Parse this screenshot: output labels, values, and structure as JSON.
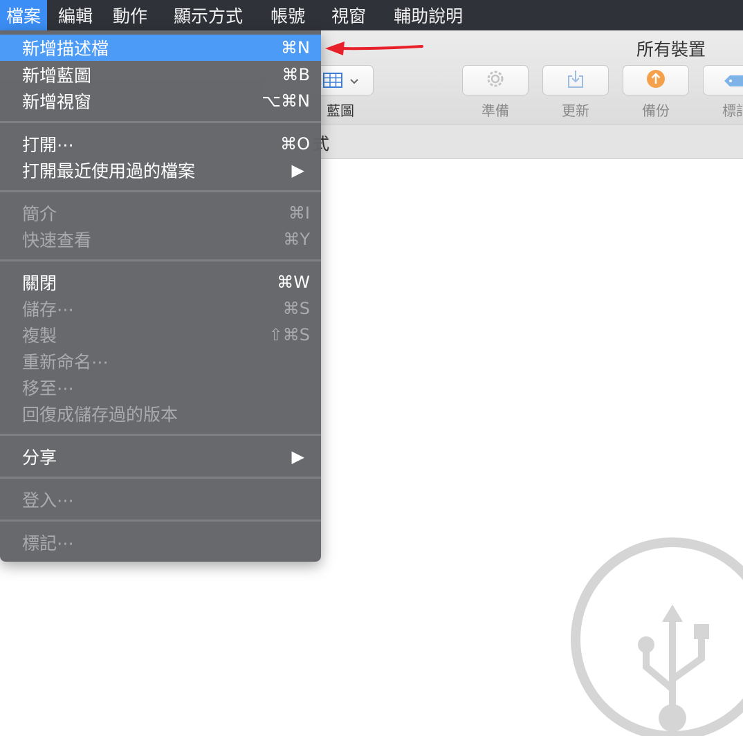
{
  "menubar": {
    "items": [
      "檔案",
      "編輯",
      "動作",
      "顯示方式",
      "帳號",
      "視窗",
      "輔助說明"
    ]
  },
  "window": {
    "title": "所有裝置",
    "toolbar": {
      "view_label": "藍圖",
      "prepare_label": "準備",
      "update_label": "更新",
      "backup_label": "備份",
      "tag_label": "標記"
    },
    "subbar_text": "式"
  },
  "file_menu": {
    "items": [
      {
        "label": "新增描述檔",
        "shortcut": "⌘N"
      },
      {
        "label": "新增藍圖",
        "shortcut": "⌘B"
      },
      {
        "label": "新增視窗",
        "shortcut": "⌥⌘N"
      },
      {
        "label": "打開⋯",
        "shortcut": "⌘O"
      },
      {
        "label": "打開最近使用過的檔案",
        "shortcut": "▶"
      },
      {
        "label": "簡介",
        "shortcut": "⌘I"
      },
      {
        "label": "快速查看",
        "shortcut": "⌘Y"
      },
      {
        "label": "關閉",
        "shortcut": "⌘W"
      },
      {
        "label": "儲存⋯",
        "shortcut": "⌘S"
      },
      {
        "label": "複製",
        "shortcut": "⇧⌘S"
      },
      {
        "label": "重新命名⋯",
        "shortcut": ""
      },
      {
        "label": "移至⋯",
        "shortcut": ""
      },
      {
        "label": "回復成儲存過的版本",
        "shortcut": ""
      },
      {
        "label": "分享",
        "shortcut": "▶"
      },
      {
        "label": "登入⋯",
        "shortcut": ""
      },
      {
        "label": "標記⋯",
        "shortcut": ""
      }
    ]
  },
  "colors": {
    "menubar_bg": "#2f3238",
    "highlight": "#4c9bf6",
    "menu_bg": "#626468",
    "disabled_text": "#a9abae",
    "annotation_arrow": "#e8202a",
    "backup_icon": "#f5a04a"
  },
  "icons": {
    "view": "grid-icon",
    "prepare": "gear-icon",
    "update": "download-icon",
    "backup": "upload-circle-icon",
    "tag": "tag-icon",
    "watermark": "usb-icon"
  }
}
